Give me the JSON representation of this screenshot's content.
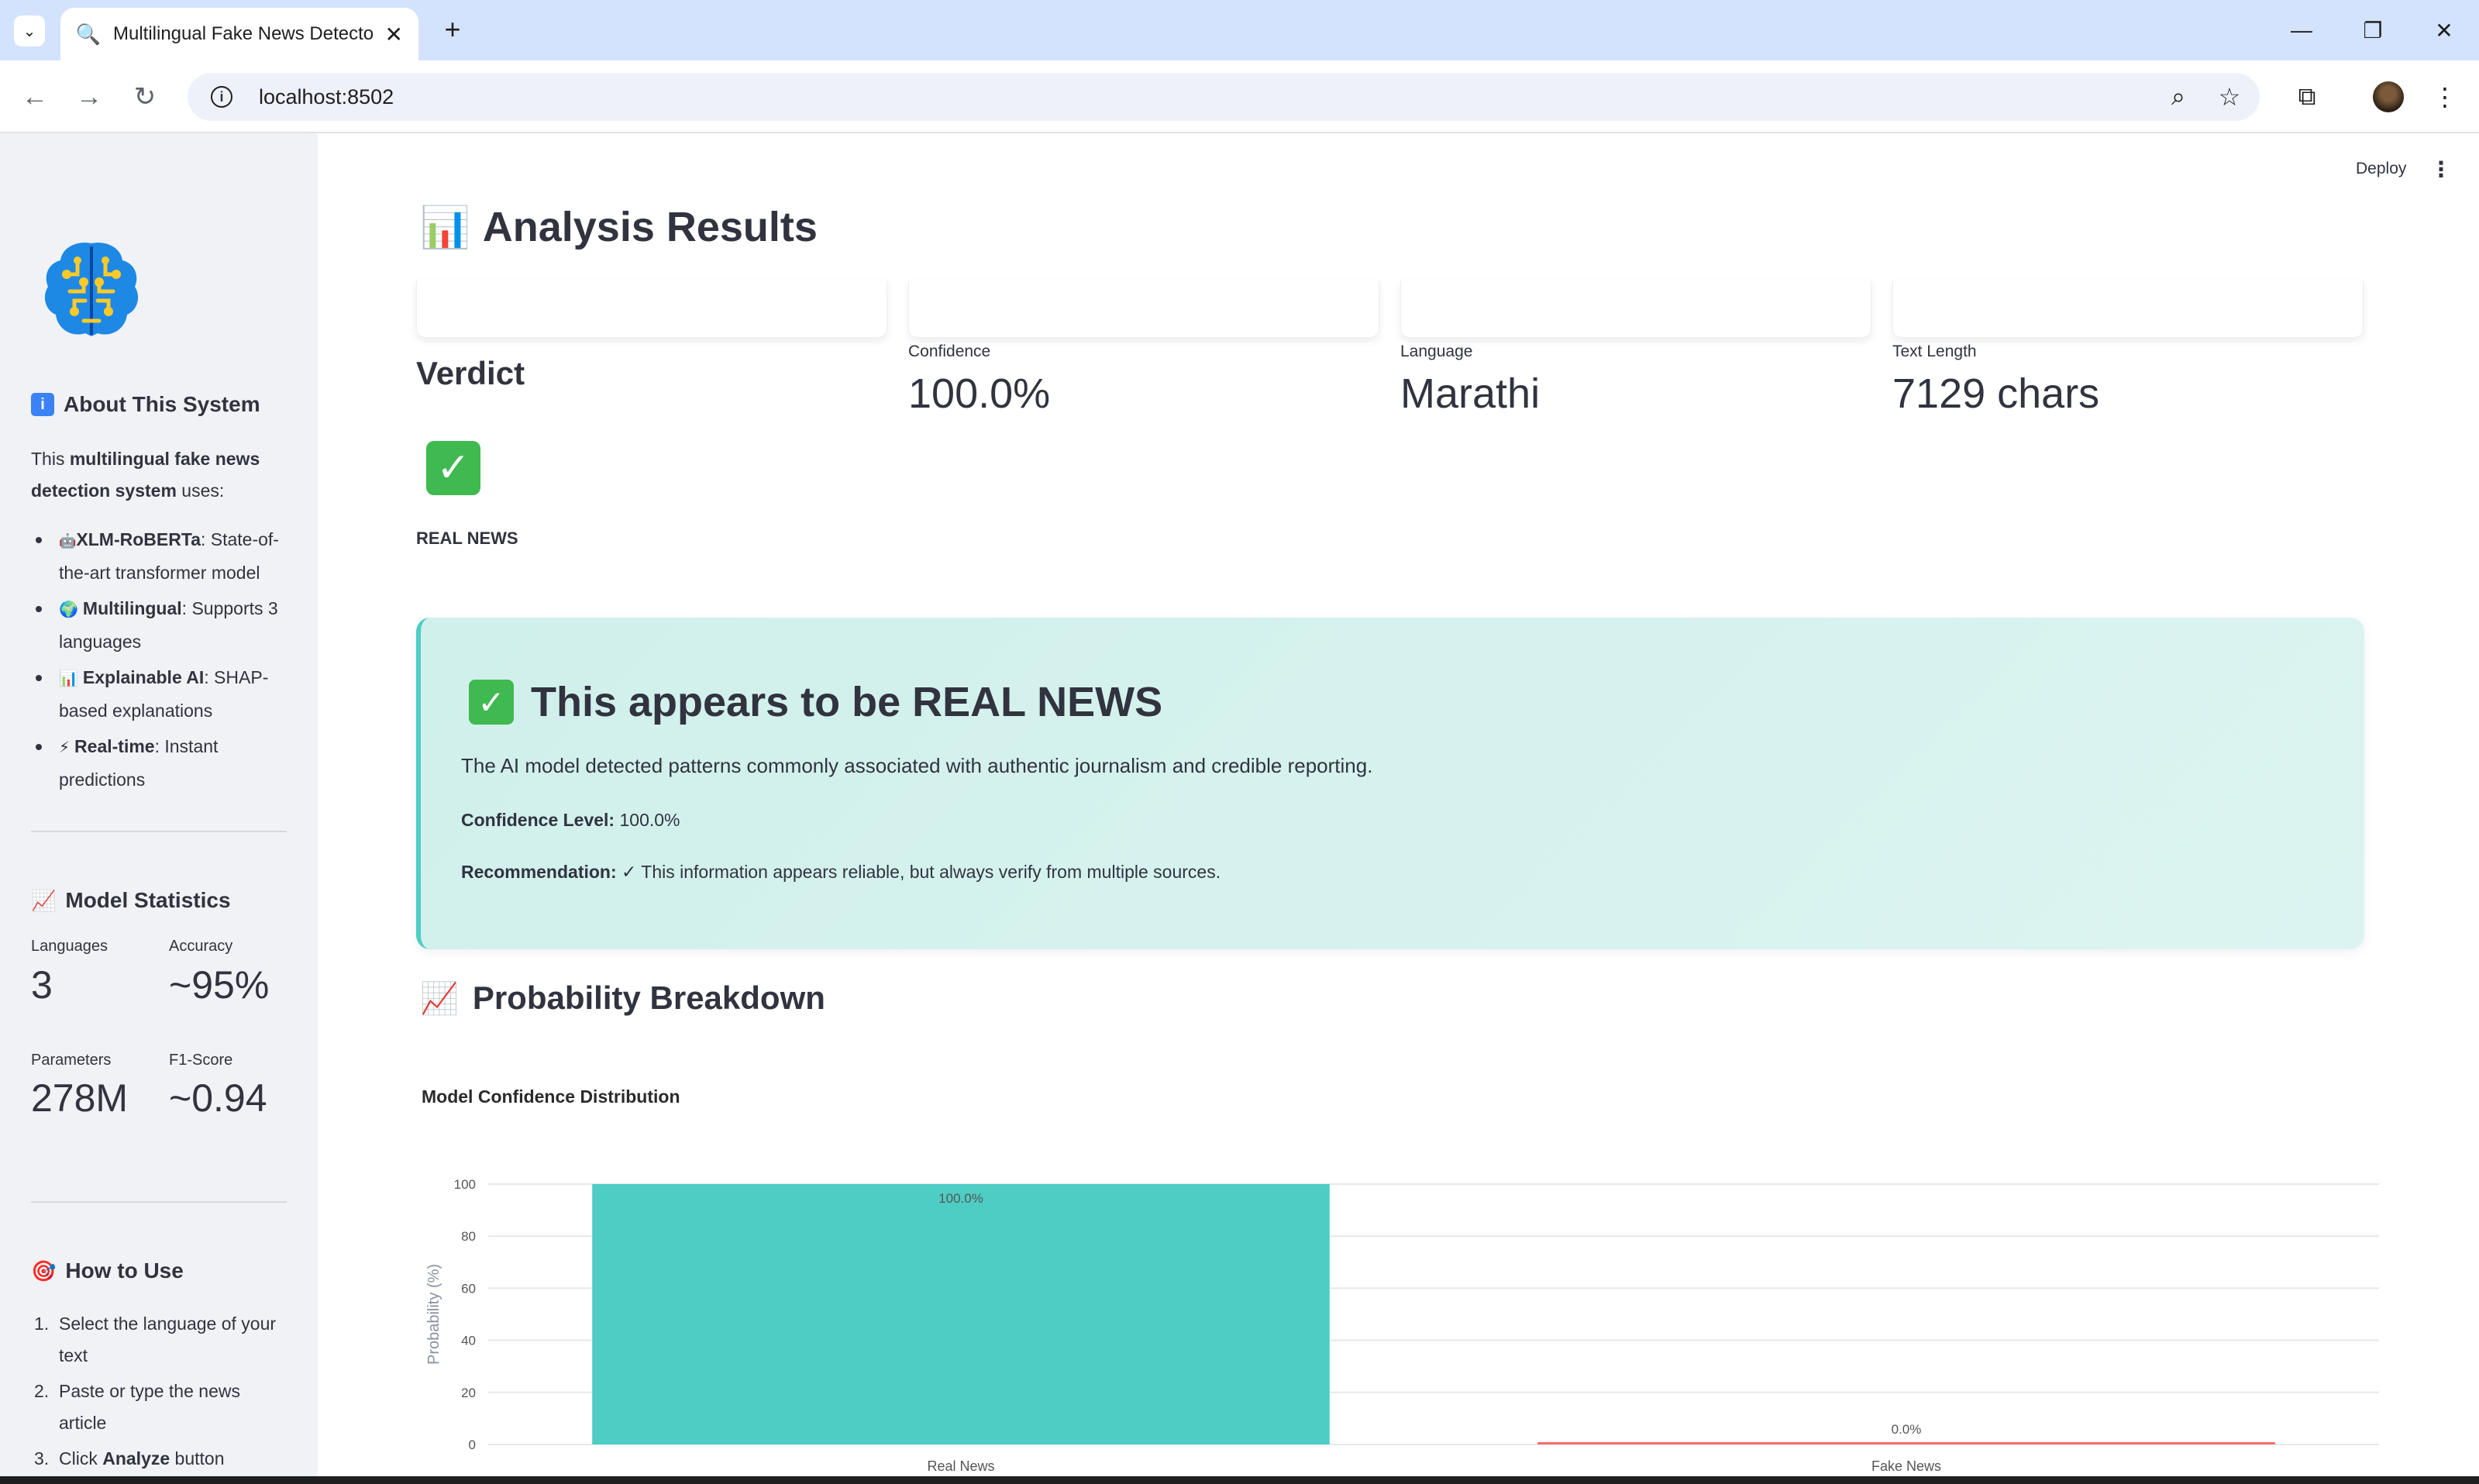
{
  "browser": {
    "tab_title": "Multilingual Fake News Detecto",
    "new_tab": "+",
    "url": "localhost:8502"
  },
  "sidebar": {
    "about": {
      "heading": "About This System",
      "intro_pre": "This ",
      "intro_bold": "multilingual fake news detection system",
      "intro_post": " uses:",
      "items": [
        {
          "emoji": "🤖",
          "bold": "XLM-RoBERTa",
          "text": ": State-of-the-art transformer model"
        },
        {
          "emoji": "🌍",
          "bold": "Multilingual",
          "text": ": Supports 3 languages"
        },
        {
          "emoji": "📊",
          "bold": "Explainable AI",
          "text": ": SHAP-based explanations"
        },
        {
          "emoji": "⚡",
          "bold": "Real-time",
          "text": ": Instant predictions"
        }
      ]
    },
    "stats": {
      "heading": "Model Statistics",
      "metrics": [
        {
          "label": "Languages",
          "value": "3"
        },
        {
          "label": "Accuracy",
          "value": "~95%"
        },
        {
          "label": "Parameters",
          "value": "278M"
        },
        {
          "label": "F1-Score",
          "value": "~0.94"
        }
      ]
    },
    "howto": {
      "heading": "How to Use",
      "steps": [
        {
          "num": "1.",
          "text": "Select the language of your text"
        },
        {
          "num": "2.",
          "text": "Paste or type the news article"
        },
        {
          "num": "3.",
          "pre": "Click ",
          "bold": "Analyze",
          "post": " button"
        }
      ]
    }
  },
  "main": {
    "deploy_label": "Deploy",
    "title": "Analysis Results",
    "verdict_label": "Verdict",
    "verdict_value": "REAL NEWS",
    "metrics": [
      {
        "label": "Confidence",
        "value": "100.0%"
      },
      {
        "label": "Language",
        "value": "Marathi"
      },
      {
        "label": "Text Length",
        "value": "7129 chars"
      }
    ],
    "result": {
      "title": "This appears to be REAL NEWS",
      "description": "The AI model detected patterns commonly associated with authentic journalism and credible reporting.",
      "confidence_label": "Confidence Level:",
      "confidence_value": "100.0%",
      "recommendation_label": "Recommendation:",
      "recommendation_value": "✓ This information appears reliable, but always verify from multiple sources."
    },
    "breakdown_title": "Probability Breakdown"
  },
  "chart_data": {
    "type": "bar",
    "title": "Model Confidence Distribution",
    "categories": [
      "Real News",
      "Fake News"
    ],
    "values": [
      100.0,
      0.0
    ],
    "data_labels": [
      "100.0%",
      "0.0%"
    ],
    "colors": [
      "#4ecdc4",
      "#ff6b6b"
    ],
    "xlabel": "",
    "ylabel": "Probability (%)",
    "ylim": [
      0,
      100
    ],
    "yticks": [
      0,
      20,
      40,
      60,
      80,
      100
    ],
    "grid": true
  },
  "colors": {
    "accent": "#4ecdc4",
    "fake": "#ff6b6b",
    "success": "#3fb950"
  }
}
